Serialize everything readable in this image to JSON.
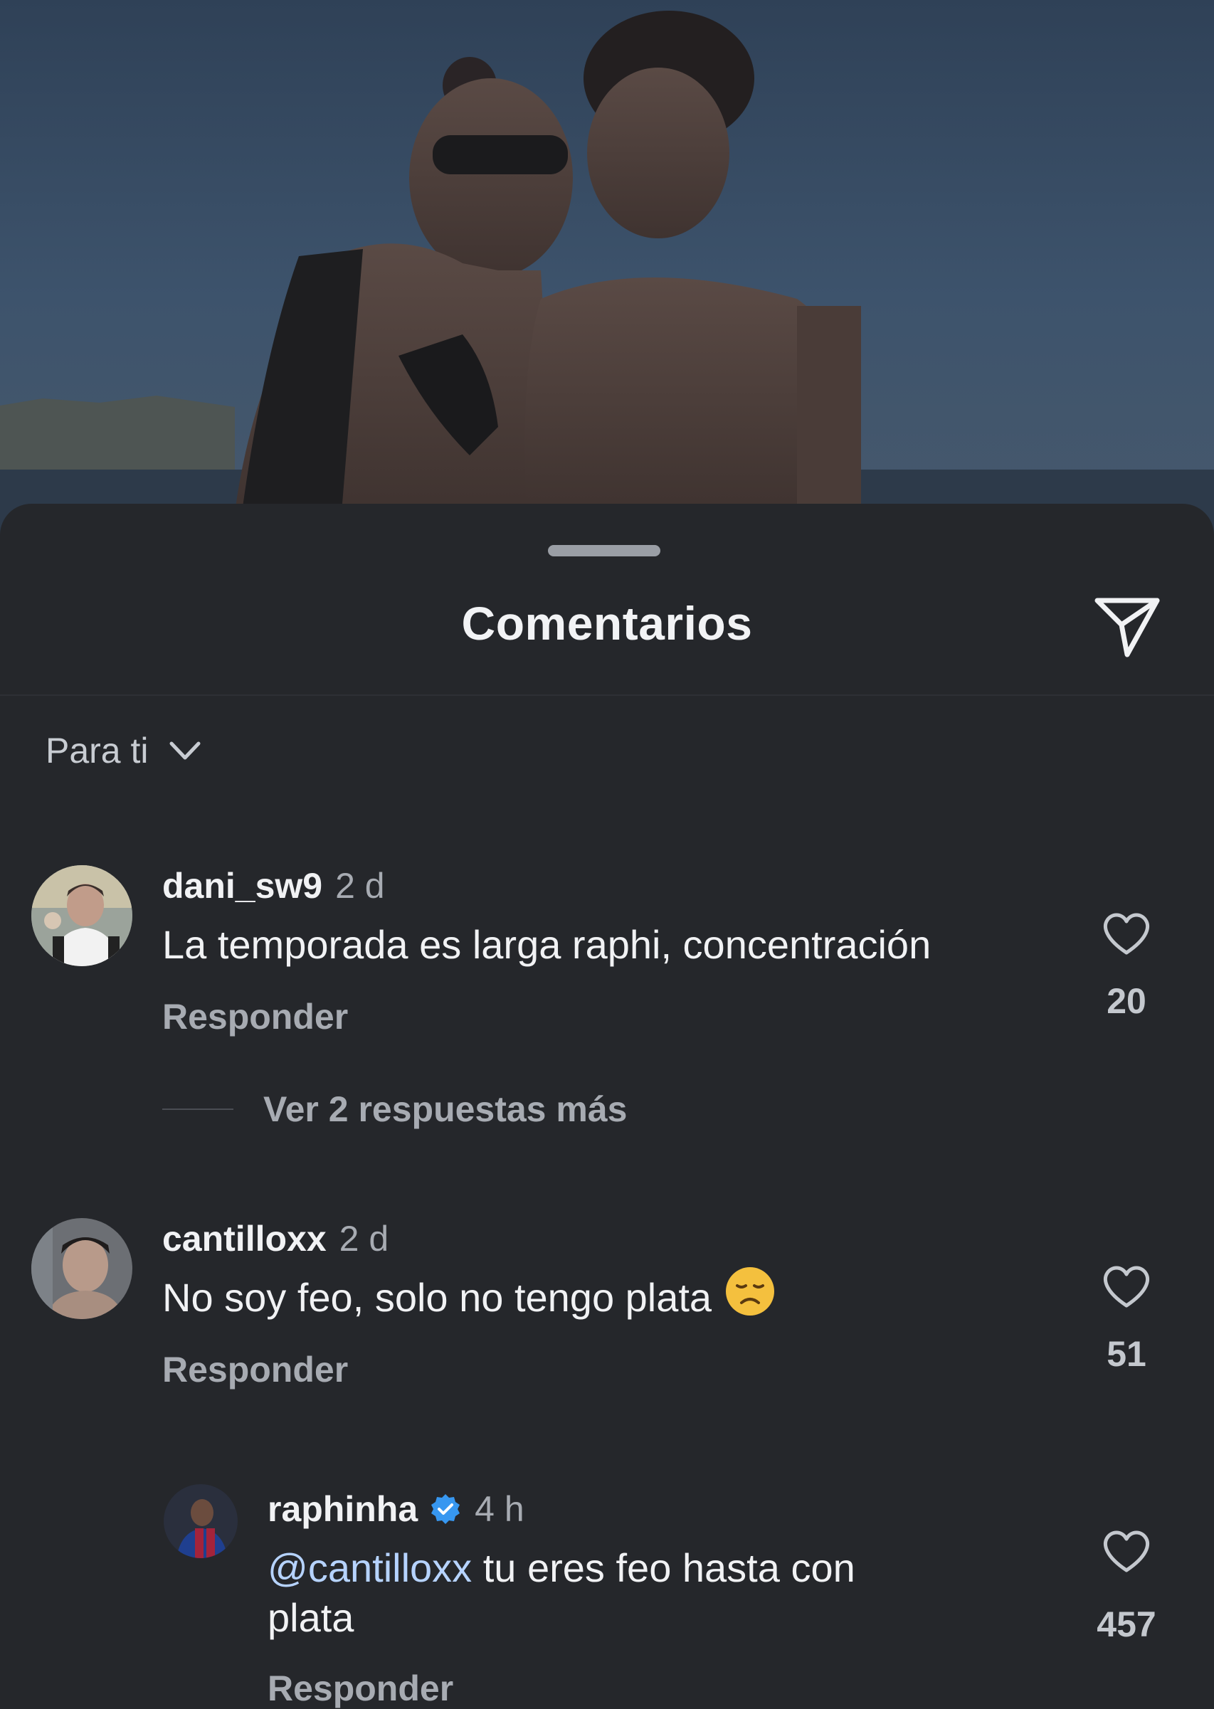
{
  "sheet": {
    "title": "Comentarios",
    "share_icon": "paper-plane-icon"
  },
  "sort": {
    "label": "Para ti",
    "icon": "chevron-down-icon"
  },
  "comments": [
    {
      "username": "dani_sw9",
      "time": "2 d",
      "text": "La temporada es larga raphi, concentración",
      "reply_label": "Responder",
      "likes": "20",
      "view_replies": "Ver 2 respuestas más"
    },
    {
      "username": "cantilloxx",
      "time": "2 d",
      "text": "No soy feo, solo no tengo plata",
      "emoji": "disappointed-face",
      "reply_label": "Responder",
      "likes": "51"
    }
  ],
  "reply": {
    "username": "raphinha",
    "verified": true,
    "time": "4 h",
    "mention": "@cantilloxx",
    "text_line1": " tu eres feo hasta con",
    "text_line2": "plata",
    "reply_label": "Responder",
    "likes": "457"
  },
  "colors": {
    "sheet_bg": "#25272b",
    "text_primary": "#f1f2f4",
    "text_secondary": "#a7abb2",
    "mention": "#b6d3ff",
    "verified": "#3797f0"
  }
}
